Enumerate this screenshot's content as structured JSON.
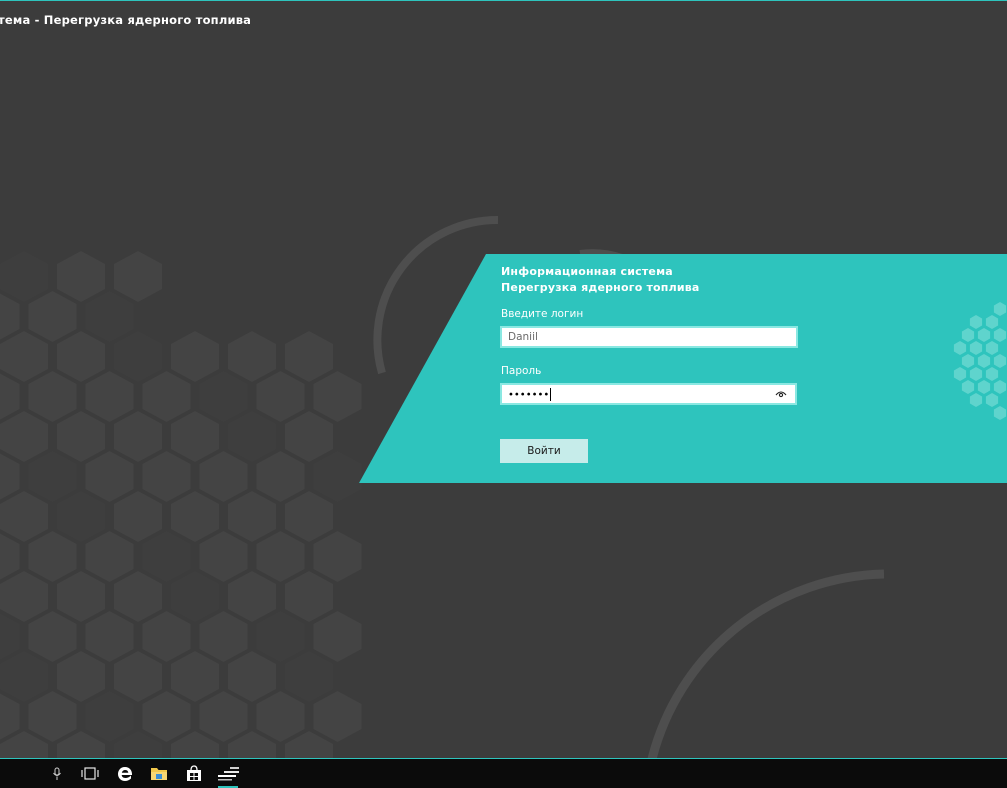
{
  "window": {
    "title": "тема - Перегрузка ядерного топлива"
  },
  "login_panel": {
    "title_line1": "Информационная система",
    "title_line2": "Перегрузка ядерного топлива",
    "login_label": "Введите логин",
    "login_value": "Daniil",
    "password_label": "Пароль",
    "password_value": "•••••••",
    "submit_label": "Войти"
  },
  "colors": {
    "accent": "#2ec4bd",
    "background": "#3c3c3c",
    "hex_tile": "#4a4a4a",
    "button": "#c6ecea",
    "taskbar": "#0b0b0b"
  },
  "taskbar": {
    "items": [
      {
        "icon": "microphone-icon"
      },
      {
        "icon": "task-view-icon"
      },
      {
        "icon": "edge-browser-icon"
      },
      {
        "icon": "file-explorer-icon"
      },
      {
        "icon": "store-icon"
      },
      {
        "icon": "app-window-icon"
      }
    ]
  }
}
